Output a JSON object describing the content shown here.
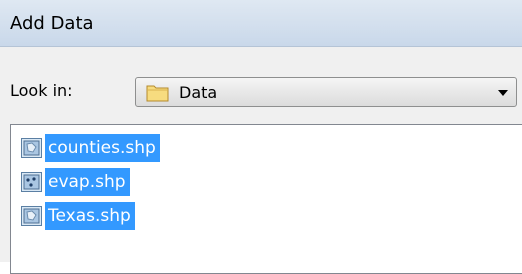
{
  "window": {
    "title": "Add Data"
  },
  "location": {
    "label": "Look in:",
    "selected_folder": "Data",
    "folder_icon": "folder-icon"
  },
  "files": [
    {
      "name": "counties.shp",
      "icon": "polygon-shapefile-icon",
      "selected": true
    },
    {
      "name": "evap.shp",
      "icon": "point-shapefile-icon",
      "selected": true
    },
    {
      "name": "Texas.shp",
      "icon": "polygon-shapefile-icon",
      "selected": true
    }
  ],
  "colors": {
    "selection": "#3399ff",
    "titlebar": "#d4e0ee"
  }
}
